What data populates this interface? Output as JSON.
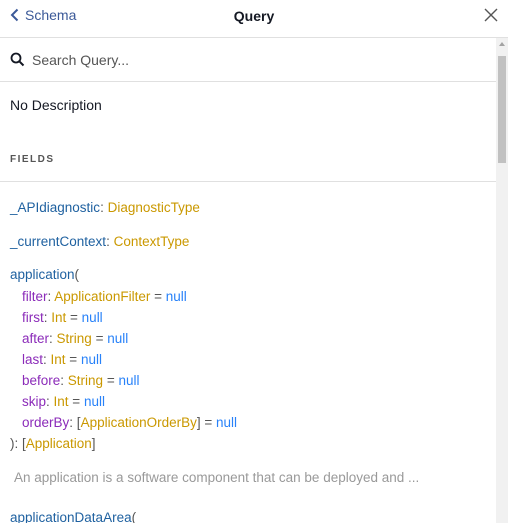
{
  "header": {
    "back_label": "Schema",
    "title": "Query",
    "back_icon": "chevron-left-icon",
    "close_icon": "close-icon"
  },
  "search": {
    "placeholder": "Search Query...",
    "value": "",
    "icon": "search-icon"
  },
  "description": "No Description",
  "section_title": "FIELDS",
  "fields": {
    "apidiag": {
      "name": "_APIdiagnostic",
      "sep": ": ",
      "type": "DiagnosticType"
    },
    "context": {
      "name": "_currentContext",
      "sep": ": ",
      "type": "ContextType"
    },
    "application": {
      "name": "application",
      "open": "(",
      "args": [
        {
          "name": "filter",
          "sep": ": ",
          "type": "ApplicationFilter",
          "eq": " = ",
          "default": "null"
        },
        {
          "name": "first",
          "sep": ": ",
          "type": "Int",
          "eq": " = ",
          "default": "null"
        },
        {
          "name": "after",
          "sep": ": ",
          "type": "String",
          "eq": " = ",
          "default": "null"
        },
        {
          "name": "last",
          "sep": ": ",
          "type": "Int",
          "eq": " = ",
          "default": "null"
        },
        {
          "name": "before",
          "sep": ": ",
          "type": "String",
          "eq": " = ",
          "default": "null"
        },
        {
          "name": "skip",
          "sep": ": ",
          "type": "Int",
          "eq": " = ",
          "default": "null"
        },
        {
          "name": "orderBy",
          "sep": ": ",
          "type_open": "[",
          "type": "ApplicationOrderBy",
          "type_close": "]",
          "eq": " = ",
          "default": "null"
        }
      ],
      "close": "): [",
      "return_type": "Application",
      "close_end": "]",
      "description": "An application is a software component that can be deployed and ..."
    },
    "appdataarea": {
      "name": "applicationDataArea",
      "open": "("
    }
  },
  "colors": {
    "field": "#1F61A0",
    "arg": "#8B2BB9",
    "type": "#CA9800",
    "keyword": "#2882F9",
    "link": "#3B5998"
  }
}
